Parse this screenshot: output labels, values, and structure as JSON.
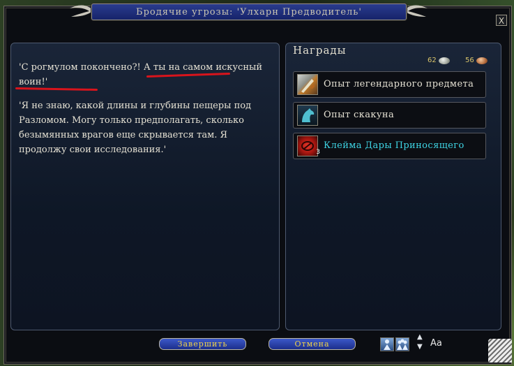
{
  "window": {
    "title": "Бродячие угрозы: 'Улхарн Предводитель'",
    "close_label": "X"
  },
  "story": {
    "paragraph1": "'С рогмулом покончено?! А ты на самом искусный воин!'",
    "paragraph2": "'Я не знаю, какой длины и глубины пещеры под Разломом. Могу только предполагать, сколько безымянных врагов еще скрывается там. Я продолжу свои исследования.'"
  },
  "rewards": {
    "title": "Награды",
    "currency": [
      {
        "amount": "62",
        "icon": "silver-coin-icon"
      },
      {
        "amount": "56",
        "icon": "copper-coin-icon"
      }
    ],
    "items": [
      {
        "label": "Опыт легендарного предмета",
        "icon": "legendary-item-icon",
        "color": "#e6e2d4"
      },
      {
        "label": "Опыт скакуна",
        "icon": "horse-icon",
        "color": "#e6e2d4"
      },
      {
        "label": "Клейма Дары Приносящего",
        "icon": "mark-icon",
        "badge": "3",
        "color": "#3fd6e6"
      }
    ]
  },
  "buttons": {
    "complete": "Завершить",
    "cancel": "Отмена"
  },
  "font_size_label": "Aa",
  "colors": {
    "accent_underline": "#d8141c",
    "button_text": "#f0d24a",
    "title_bar": "#1f2f80"
  }
}
